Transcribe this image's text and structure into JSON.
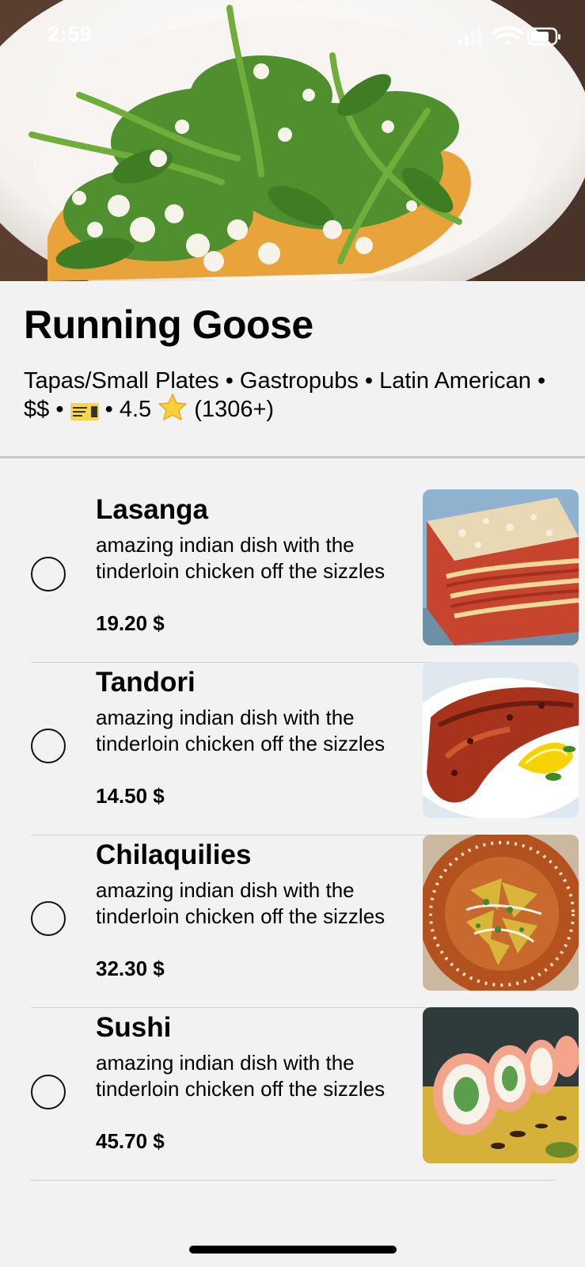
{
  "status_bar": {
    "time": "2:59",
    "icons": [
      "cellular-signal-icon",
      "wifi-icon",
      "battery-icon"
    ]
  },
  "restaurant": {
    "name": "Running Goose",
    "categories": [
      "Tapas/Small Plates",
      "Gastropubs",
      "Latin American"
    ],
    "price_level": "$$",
    "badge_icon": "concert-ticket-icon",
    "rating": "4.5",
    "rating_icon": "star-icon",
    "review_count": "(1306+)",
    "separator": "•"
  },
  "menu": {
    "items": [
      {
        "name": "Lasanga",
        "description": "amazing indian dish with the tinderloin chicken off the sizzles",
        "price": "19.20 $",
        "selected": false,
        "photo": "lasagna-photo"
      },
      {
        "name": "Tandori",
        "description": "amazing indian dish with the tinderloin chicken off the sizzles",
        "price": "14.50 $",
        "selected": false,
        "photo": "tandoori-chicken-photo"
      },
      {
        "name": "Chilaquilies",
        "description": "amazing indian dish with the tinderloin chicken off the sizzles",
        "price": "32.30 $",
        "selected": false,
        "photo": "chilaquiles-photo"
      },
      {
        "name": "Sushi",
        "description": "amazing indian dish with the tinderloin chicken off the sizzles",
        "price": "45.70 $",
        "selected": false,
        "photo": "sushi-photo"
      }
    ]
  },
  "colors": {
    "background": "#f2f2f2",
    "divider": "#c8c8cc",
    "text": "#000000",
    "status_text": "#ffffff"
  }
}
